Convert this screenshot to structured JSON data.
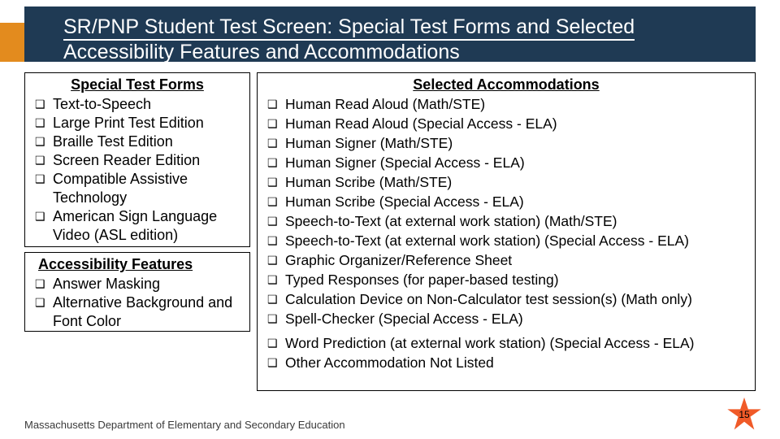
{
  "title": "SR/PNP Student Test Screen: Special Test Forms and Selected Accessibility Features and Accommodations",
  "panels": {
    "forms": {
      "heading": "Special Test Forms",
      "items": [
        "Text-to-Speech",
        "Large Print Test Edition",
        "Braille Test Edition",
        "Screen Reader Edition",
        "Compatible Assistive Technology",
        "American Sign Language Video (ASL edition)"
      ]
    },
    "access": {
      "heading": "Accessibility Features",
      "items": [
        "Answer Masking",
        "Alternative Background and Font Color"
      ]
    },
    "accom": {
      "heading": "Selected Accommodations",
      "items": [
        "Human Read Aloud (Math/STE)",
        "Human Read Aloud (Special Access - ELA)",
        "Human Signer (Math/STE)",
        "Human Signer (Special Access - ELA)",
        "Human Scribe (Math/STE)",
        "Human Scribe (Special Access - ELA)",
        "Speech-to-Text (at external work station) (Math/STE)",
        "Speech-to-Text (at external work station) (Special Access - ELA)",
        "Graphic Organizer/Reference Sheet",
        "Typed Responses (for paper-based testing)",
        "Calculation Device on Non-Calculator test session(s) (Math only)",
        "Spell-Checker (Special Access - ELA)"
      ],
      "items_after_gap": [
        "Word Prediction (at external work station) (Special Access - ELA)",
        "Other Accommodation Not Listed"
      ]
    }
  },
  "footer": "Massachusetts Department of Elementary and Secondary Education",
  "page_number": "15",
  "colors": {
    "header_bg": "#1f3a54",
    "accent": "#e38b1e",
    "star": "#f05a28"
  }
}
